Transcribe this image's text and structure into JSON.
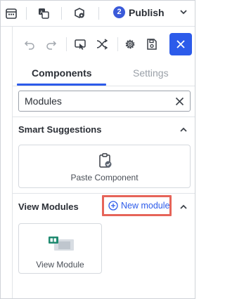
{
  "topbar": {
    "icons": [
      "calendar-icon",
      "translate-icon",
      "settings-box-icon"
    ],
    "publish": {
      "count": "2",
      "label": "Publish"
    }
  },
  "toolbar": {
    "icons": [
      "undo-icon",
      "redo-icon",
      "preview-icon",
      "shuffle-icon",
      "gear-icon",
      "save-icon",
      "close-icon"
    ]
  },
  "tabs": [
    {
      "label": "Components",
      "active": true
    },
    {
      "label": "Settings",
      "active": false
    }
  ],
  "search": {
    "value": "Modules"
  },
  "sections": {
    "smart_suggestions": {
      "title": "Smart Suggestions",
      "cards": [
        {
          "label": "Paste Component",
          "icon": "clipboard-check-icon"
        }
      ]
    },
    "view_modules": {
      "title": "View Modules",
      "action_label": "New module",
      "cards": [
        {
          "label": "View Module",
          "icon": "module-preview-icon"
        }
      ]
    }
  },
  "colors": {
    "accent": "#2c5bea",
    "highlight": "#e66459"
  }
}
